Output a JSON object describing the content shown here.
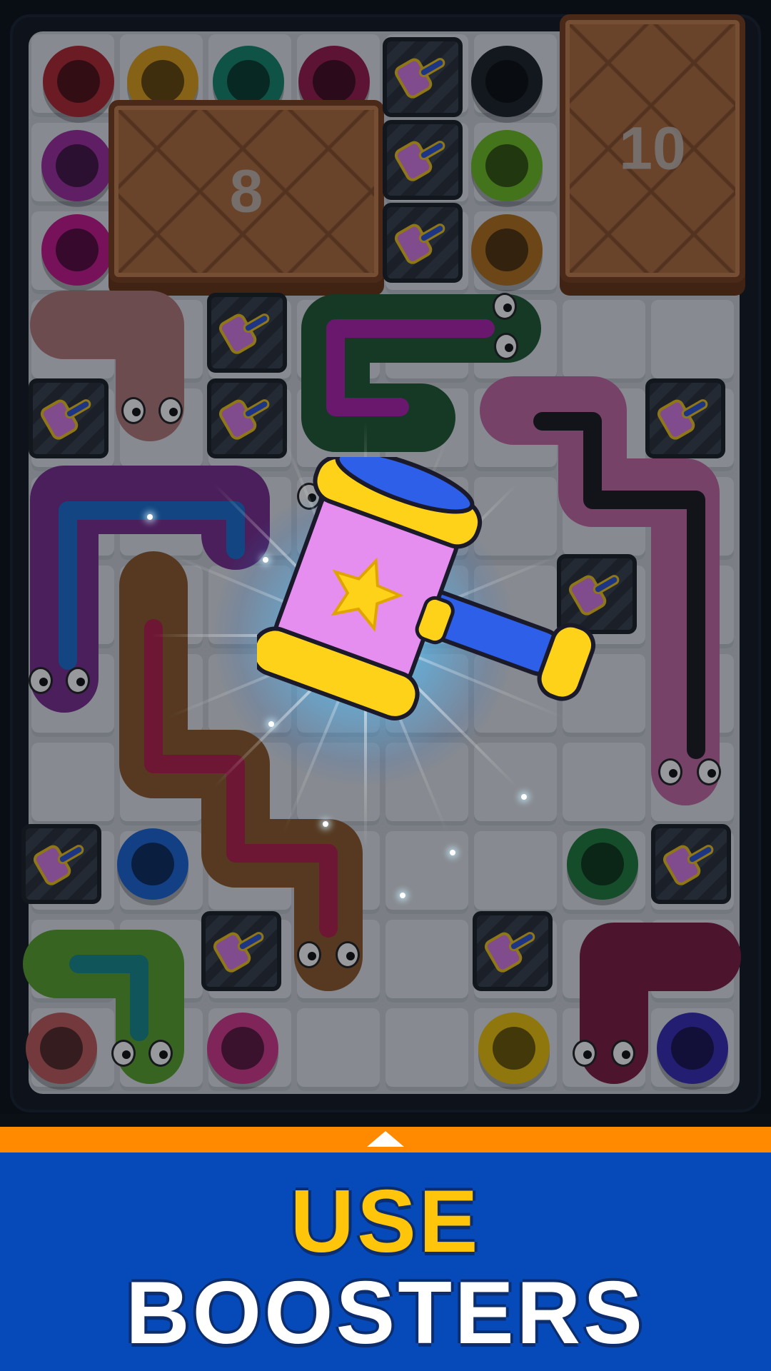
{
  "crates": [
    {
      "name": "crate-left",
      "count": "8"
    },
    {
      "name": "crate-right",
      "count": "10"
    }
  ],
  "holes": [
    {
      "color": "#b3262f"
    },
    {
      "color": "#e2a019"
    },
    {
      "color": "#13876a"
    },
    {
      "color": "#9c1a4c"
    },
    {
      "color": "#1c1f26"
    },
    {
      "color": "#a02ca0"
    },
    {
      "color": "#6fbe1f"
    },
    {
      "color": "#c9168e"
    },
    {
      "color": "#b6701b"
    },
    {
      "color": "#1d67d8"
    },
    {
      "color": "#1f7a3a"
    },
    {
      "color": "#c25a5a"
    },
    {
      "color": "#d8378e"
    },
    {
      "color": "#f2c40a"
    },
    {
      "color": "#3a2cb8"
    }
  ],
  "booster": {
    "name": "hammer-booster",
    "head_color": "#e58ef0",
    "band_color": "#ffd21a",
    "handle_color": "#2d5fe8",
    "glow_color": "#57c8ff"
  },
  "banner": {
    "stripe_color": "#ff8a00",
    "background_color": "#0649b8",
    "line1": "USE",
    "line2": "BOOSTERS"
  }
}
